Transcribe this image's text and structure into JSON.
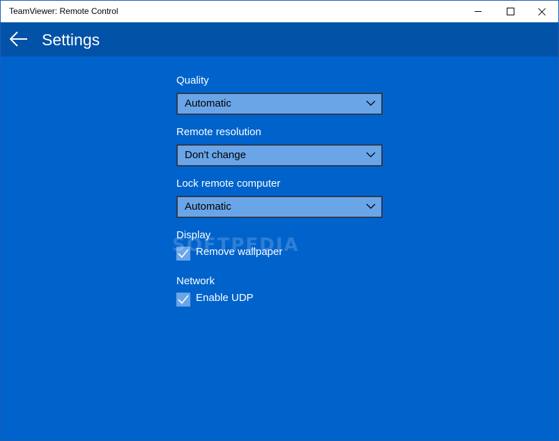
{
  "window": {
    "title": "TeamViewer: Remote Control",
    "controls": {
      "minimize": "minimize",
      "maximize": "maximize",
      "close": "close"
    }
  },
  "header": {
    "back_icon": "arrow-left-icon",
    "title": "Settings"
  },
  "settings": {
    "quality": {
      "label": "Quality",
      "value": "Automatic"
    },
    "remote_resolution": {
      "label": "Remote resolution",
      "value": "Don't change"
    },
    "lock_remote_computer": {
      "label": "Lock remote computer",
      "value": "Automatic"
    },
    "display": {
      "label": "Display",
      "remove_wallpaper": {
        "label": "Remove wallpaper",
        "checked": true
      }
    },
    "network": {
      "label": "Network",
      "enable_udp": {
        "label": "Enable UDP",
        "checked": true
      }
    }
  },
  "watermark": "SOFTPEDIA",
  "colors": {
    "background": "#0063cc",
    "header": "#0252a8",
    "combo_fill": "#6aa5e8",
    "combo_border": "#2a3a55"
  }
}
